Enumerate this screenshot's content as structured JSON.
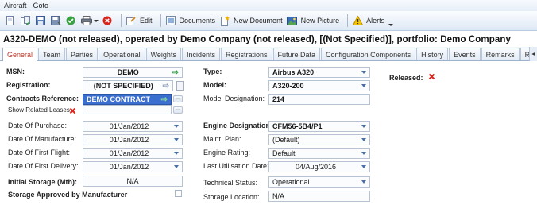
{
  "menu": {
    "items": [
      "Aircraft",
      "Goto"
    ]
  },
  "toolbar": {
    "edit_label": "Edit",
    "documents_label": "Documents",
    "new_document_label": "New Document",
    "new_picture_label": "New Picture",
    "alerts_label": "Alerts"
  },
  "page_title": "A320-DEMO (not released), operated by Demo Company (not released), [(Not Specified)], portfolio: Demo Company",
  "tabs": [
    {
      "label": "General"
    },
    {
      "label": "Team"
    },
    {
      "label": "Parties"
    },
    {
      "label": "Operational"
    },
    {
      "label": "Weights"
    },
    {
      "label": "Incidents"
    },
    {
      "label": "Registrations"
    },
    {
      "label": "Future Data"
    },
    {
      "label": "Configuration Components"
    },
    {
      "label": "History"
    },
    {
      "label": "Events"
    },
    {
      "label": "Remarks"
    },
    {
      "label": "Requ"
    }
  ],
  "colors": {
    "accent": "#3a6fd0",
    "active_tab_text": "#c0392b",
    "alert_red": "#d9261c",
    "ok_green": "#2e9e3a"
  },
  "left": {
    "msn_label": "MSN:",
    "msn_value": "DEMO",
    "registration_label": "Registration:",
    "registration_value": "(NOT SPECIFIED)",
    "contracts_label": "Contracts Reference:",
    "contracts_value": "DEMO CONTRACT",
    "show_leases_label": "Show Related Leases:",
    "date_purchase_label": "Date Of Purchase:",
    "date_purchase_value": "01/Jan/2012",
    "date_manufacture_label": "Date Of Manufacture:",
    "date_manufacture_value": "01/Jan/2012",
    "date_first_flight_label": "Date Of First Flight:",
    "date_first_flight_value": "01/Jan/2012",
    "date_first_delivery_label": "Date Of First Delivery:",
    "date_first_delivery_value": "01/Jan/2012",
    "initial_storage_label": "Initial Storage (Mth):",
    "initial_storage_value": "N/A",
    "storage_approved_label": "Storage Approved by Manufacturer"
  },
  "middle": {
    "type_label": "Type:",
    "type_value": "Airbus A320",
    "model_label": "Model:",
    "model_value": "A320-200",
    "model_designation_label": "Model Designation:",
    "model_designation_value": "214",
    "engine_designation_label": "Engine Designation:",
    "engine_designation_value": "CFM56-5B4/P1",
    "maint_plan_label": "Maint. Plan:",
    "maint_plan_value": "(Default)",
    "engine_rating_label": "Engine Rating:",
    "engine_rating_value": "Default",
    "last_util_label": "Last Utilisation Date:",
    "last_util_value": "04/Aug/2016",
    "technical_status_label": "Technical Status:",
    "technical_status_value": "Operational",
    "storage_location_label": "Storage Location:",
    "storage_location_value": "N/A"
  },
  "right": {
    "released_label": "Released:"
  }
}
